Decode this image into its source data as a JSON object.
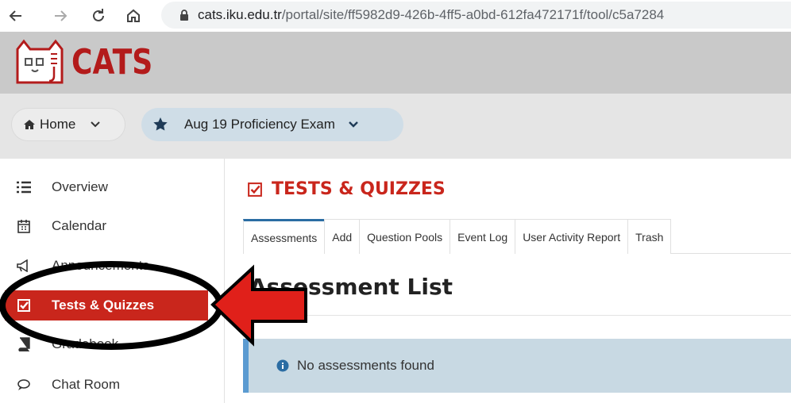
{
  "browser": {
    "url_host": "cats.iku.edu.tr",
    "url_path": "/portal/site/ff5982d9-426b-4ff5-a0bd-612fa472171f/tool/c5a7284"
  },
  "header": {
    "logo_text": "CATS"
  },
  "breadcrumb": {
    "home_label": "Home",
    "site_label": "Aug 19 Proficiency Exam"
  },
  "sidebar": {
    "items": [
      {
        "label": "Overview",
        "icon": "list-icon"
      },
      {
        "label": "Calendar",
        "icon": "calendar-icon"
      },
      {
        "label": "Announcements",
        "icon": "megaphone-icon"
      },
      {
        "label": "Tests & Quizzes",
        "icon": "checkbox-icon",
        "active": true
      },
      {
        "label": "Gradebook",
        "icon": "book-icon"
      },
      {
        "label": "Chat Room",
        "icon": "chat-icon"
      }
    ]
  },
  "main": {
    "tool_title": "TESTS & QUIZZES",
    "tabs": [
      {
        "label": "Assessments",
        "active": true
      },
      {
        "label": "Add"
      },
      {
        "label": "Question Pools"
      },
      {
        "label": "Event Log"
      },
      {
        "label": "User Activity Report"
      },
      {
        "label": "Trash"
      }
    ],
    "heading": "Assessment List",
    "alert_text": "No assessments found"
  },
  "colors": {
    "accent_red": "#c9261c",
    "tab_active_blue": "#2b6da3",
    "alert_bg": "#c8d9e3"
  }
}
